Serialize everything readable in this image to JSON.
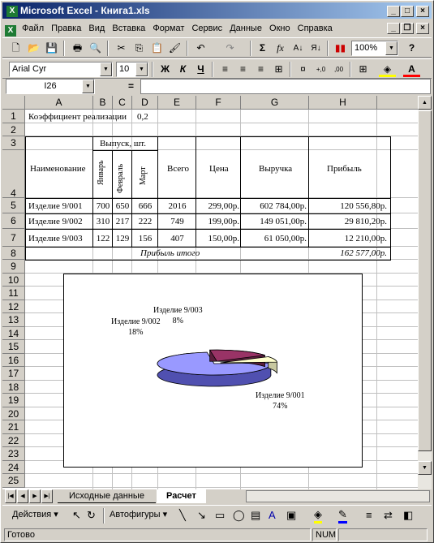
{
  "window": {
    "title": "Microsoft Excel - Книга1.xls"
  },
  "menu": [
    "Файл",
    "Правка",
    "Вид",
    "Вставка",
    "Формат",
    "Сервис",
    "Данные",
    "Окно",
    "Справка"
  ],
  "toolbar": {
    "zoom": "100%",
    "font": "Arial Cyr",
    "size": "10",
    "bold": "Ж",
    "italic": "К",
    "underline": "Ч",
    "sigma": "Σ",
    "fx": "fx"
  },
  "formula": {
    "namebox": "I26",
    "equals": "="
  },
  "columns": [
    "A",
    "B",
    "C",
    "D",
    "E",
    "F",
    "G",
    "H"
  ],
  "rows": [
    "1",
    "2",
    "3",
    "4",
    "5",
    "6",
    "7",
    "8",
    "9",
    "10",
    "11",
    "12",
    "13",
    "14",
    "15",
    "16",
    "17",
    "18",
    "19",
    "20",
    "21",
    "22",
    "23",
    "24",
    "25"
  ],
  "sheet": {
    "a1": "Коэффициент реализации",
    "d1": "0,2",
    "a3": "Наименование",
    "b3": "Выпуск, шт.",
    "b4": "Январь",
    "c4": "Февраль",
    "d4": "Март",
    "e3": "Всего",
    "f3": "Цена",
    "g3": "Выручка",
    "h3": "Прибыль",
    "data": [
      {
        "name": "Изделие 9/001",
        "jan": "700",
        "feb": "650",
        "mar": "666",
        "total": "2016",
        "price": "299,00р.",
        "rev": "602 784,00р.",
        "profit": "120 556,80р."
      },
      {
        "name": "Изделие 9/002",
        "jan": "310",
        "feb": "217",
        "mar": "222",
        "total": "749",
        "price": "199,00р.",
        "rev": "149 051,00р.",
        "profit": "29 810,20р."
      },
      {
        "name": "Изделие 9/003",
        "jan": "122",
        "feb": "129",
        "mar": "156",
        "total": "407",
        "price": "150,00р.",
        "rev": "61 050,00р.",
        "profit": "12 210,00р."
      }
    ],
    "total_label": "Прибыль итого",
    "total_value": "162 577,00р."
  },
  "chart_data": {
    "type": "pie",
    "categories": [
      "Изделие 9/001",
      "Изделие 9/002",
      "Изделие 9/003"
    ],
    "values": [
      74,
      18,
      8
    ],
    "labels": [
      "74%",
      "18%",
      "8%"
    ],
    "colors": [
      "#9999ff",
      "#993366",
      "#ffffcc"
    ]
  },
  "tabs": {
    "sheet1": "Исходные данные",
    "sheet2": "Расчет"
  },
  "drawbar": {
    "actions": "Действия",
    "autoshapes": "Автофигуры"
  },
  "status": {
    "ready": "Готово",
    "num": "NUM"
  }
}
